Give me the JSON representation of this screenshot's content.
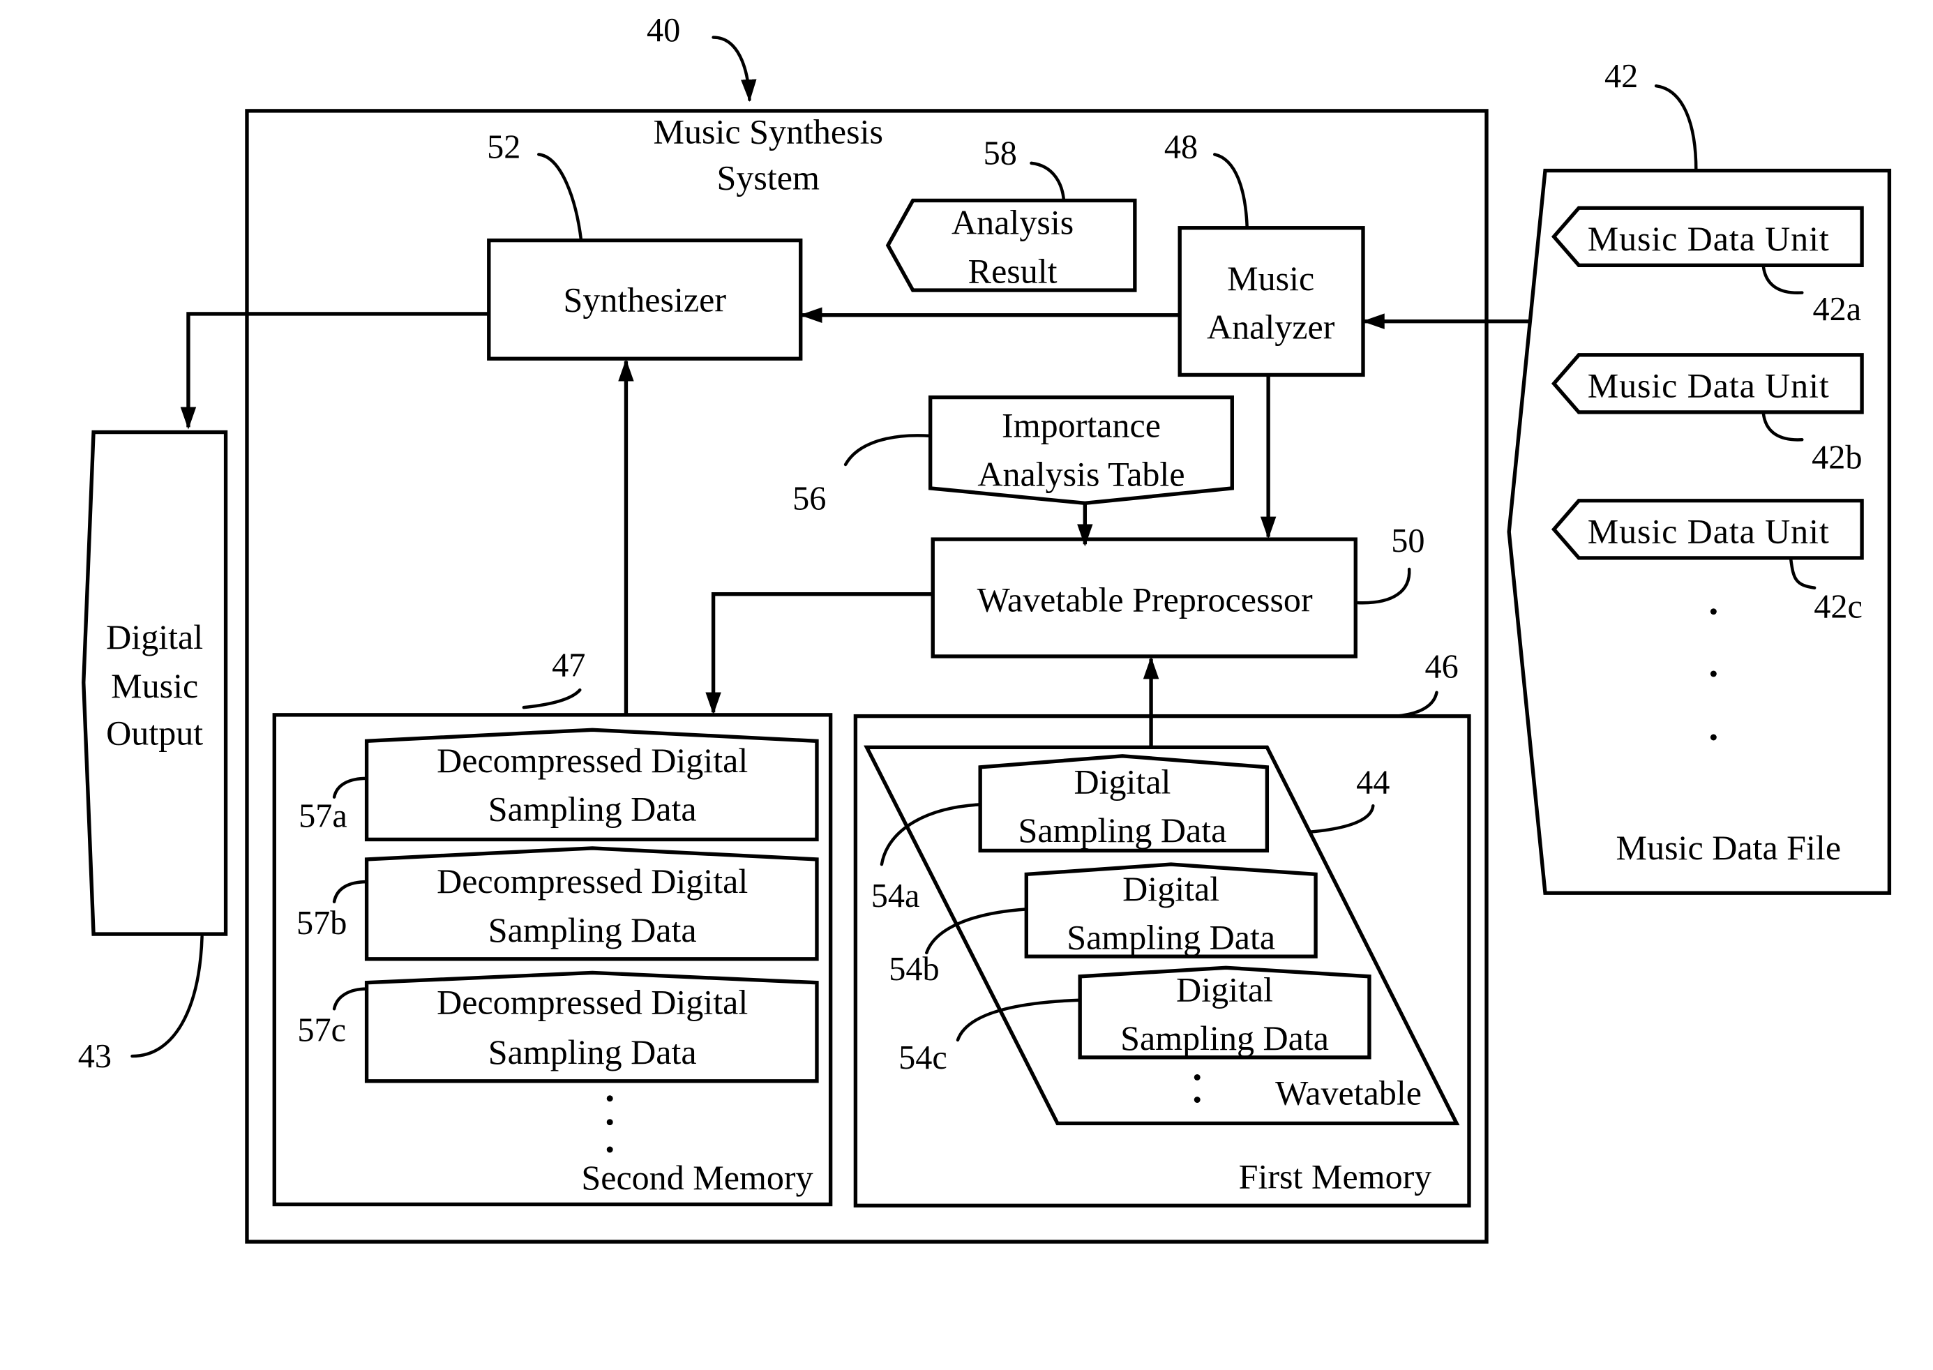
{
  "figure": {
    "system": {
      "title_line1": "Music Synthesis",
      "title_line2": "System",
      "ref": "40"
    },
    "synthesizer": {
      "label": "Synthesizer",
      "ref": "52"
    },
    "analysis_result": {
      "line1": "Analysis",
      "line2": "Result",
      "ref": "58"
    },
    "music_analyzer": {
      "line1": "Music",
      "line2": "Analyzer",
      "ref": "48"
    },
    "importance_table": {
      "line1": "Importance",
      "line2": "Analysis Table",
      "ref": "56"
    },
    "wavetable_preprocessor": {
      "label": "Wavetable Preprocessor",
      "ref": "50"
    },
    "second_memory": {
      "label": "Second Memory",
      "ref": "47",
      "items": [
        {
          "line1": "Decompressed Digital",
          "line2": "Sampling Data",
          "ref": "57a"
        },
        {
          "line1": "Decompressed Digital",
          "line2": "Sampling Data",
          "ref": "57b"
        },
        {
          "line1": "Decompressed Digital",
          "line2": "Sampling Data",
          "ref": "57c"
        }
      ]
    },
    "first_memory": {
      "label": "First Memory",
      "ref": "46",
      "wavetable": {
        "label": "Wavetable",
        "ref": "44",
        "items": [
          {
            "line1": "Digital",
            "line2": "Sampling Data",
            "ref": "54a"
          },
          {
            "line1": "Digital",
            "line2": "Sampling Data",
            "ref": "54b"
          },
          {
            "line1": "Digital",
            "line2": "Sampling Data",
            "ref": "54c"
          }
        ]
      }
    },
    "music_data_file": {
      "label": "Music Data File",
      "ref": "42",
      "units": [
        {
          "label": "Music Data Unit",
          "ref": "42a"
        },
        {
          "label": "Music Data Unit",
          "ref": "42b"
        },
        {
          "label": "Music Data Unit",
          "ref": "42c"
        }
      ]
    },
    "digital_music_output": {
      "line1": "Digital",
      "line2": "Music",
      "line3": "Output",
      "ref": "43"
    }
  }
}
